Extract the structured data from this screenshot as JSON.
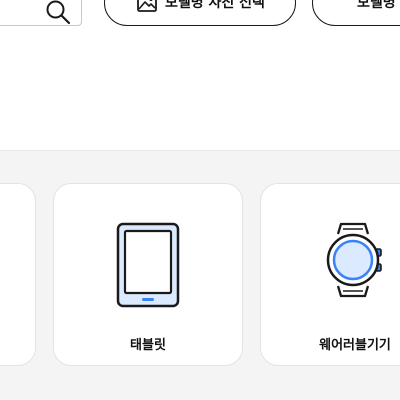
{
  "toolbar": {
    "photo_search_label": "모델명 사진 선택",
    "second_button_label": "모델명"
  },
  "categories": [
    {
      "label": "",
      "icon": "unknown"
    },
    {
      "label": "태블릿",
      "icon": "tablet-icon"
    },
    {
      "label": "웨어러블기기",
      "icon": "smartwatch-icon"
    }
  ],
  "colors": {
    "accent_blue": "#3b82f6",
    "icon_fill_light_blue": "#dbeafe",
    "outline": "#1a1a1a",
    "strip_background": "#f4f4f4"
  }
}
